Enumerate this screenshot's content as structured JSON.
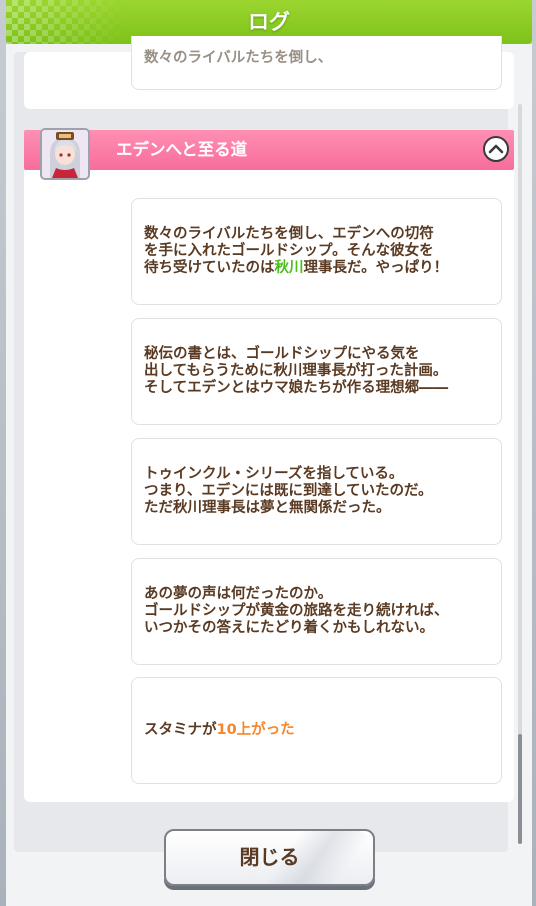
{
  "header": {
    "title": "ログ"
  },
  "section": {
    "title": "エデンへと至る道"
  },
  "top_partial": {
    "text": "数々のライバルたちを倒し、"
  },
  "messages": [
    {
      "lines": [
        [
          {
            "t": "数々のライバルたちを倒し、エデンへの切符"
          }
        ],
        [
          {
            "t": "を手に入れたゴールドシップ。そんな彼女を"
          }
        ],
        [
          {
            "t": "待ち受けていたのは"
          },
          {
            "t": "秋川",
            "c": "green"
          },
          {
            "t": "理事長だ。やっぱり！"
          }
        ]
      ]
    },
    {
      "lines": [
        [
          {
            "t": "秘伝の書とは、ゴールドシップにやる気を"
          }
        ],
        [
          {
            "t": "出してもらうために秋川理事長が打った計画。"
          }
        ],
        [
          {
            "t": "そしてエデンとはウマ娘たちが作る理想郷――"
          }
        ]
      ]
    },
    {
      "lines": [
        [
          {
            "t": "トゥインクル・シリーズを指している。"
          }
        ],
        [
          {
            "t": "つまり、エデンには既に到達していたのだ。"
          }
        ],
        [
          {
            "t": "ただ秋川理事長は夢と無関係だった。"
          }
        ]
      ]
    },
    {
      "lines": [
        [
          {
            "t": "あの夢の声は何だったのか。"
          }
        ],
        [
          {
            "t": "ゴールドシップが黄金の旅路を走り続ければ、"
          }
        ],
        [
          {
            "t": "いつかその答えにたどり着くかもしれない。"
          }
        ]
      ]
    },
    {
      "lines": [
        [
          {
            "t": "スタミナが"
          },
          {
            "t": "10上がった",
            "c": "orange"
          }
        ]
      ]
    }
  ],
  "close_button": {
    "label": "閉じる"
  },
  "icons": {
    "collapse": "chevron-up-icon",
    "avatar": "character-avatar"
  },
  "colors": {
    "header_green": "#8ccc24",
    "section_pink": "#f97ba3",
    "text_brown": "#5a3a22",
    "highlight_green": "#4cbf1e",
    "highlight_orange": "#f5862a"
  }
}
